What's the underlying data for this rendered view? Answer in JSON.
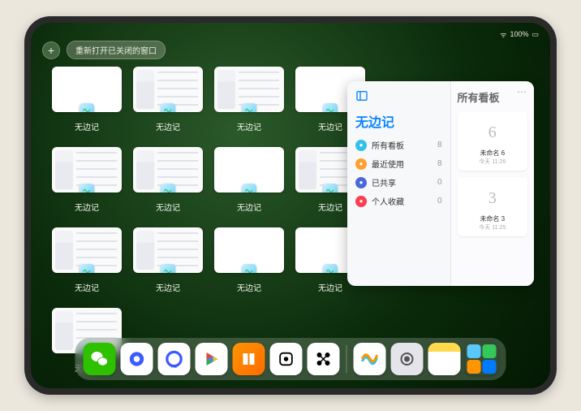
{
  "status": {
    "time": "",
    "battery": "100%",
    "signal": "••••"
  },
  "topbar": {
    "plus_label": "+",
    "reopen_label": "重新打开已关闭的窗口"
  },
  "window_label": "无边记",
  "windows": [
    {
      "variant": "blank"
    },
    {
      "variant": "content"
    },
    {
      "variant": "content"
    },
    {
      "variant": "blank"
    },
    {
      "variant": "content"
    },
    {
      "variant": "content"
    },
    {
      "variant": "blank"
    },
    {
      "variant": "content"
    },
    {
      "variant": "content"
    },
    {
      "variant": "content"
    },
    {
      "variant": "blank"
    },
    {
      "variant": "blank"
    },
    {
      "variant": "content"
    }
  ],
  "panel": {
    "title_left": "无边记",
    "title_right": "所有看板",
    "rows": [
      {
        "icon": "blue",
        "label": "所有看板",
        "count": 8
      },
      {
        "icon": "orange",
        "label": "最近使用",
        "count": 8
      },
      {
        "icon": "navy",
        "label": "已共享",
        "count": 0
      },
      {
        "icon": "red",
        "label": "个人收藏",
        "count": 0
      }
    ],
    "boards": [
      {
        "sketch": "6",
        "name": "未命名 6",
        "sub": "今天 11:26"
      },
      {
        "sketch": "3",
        "name": "未命名 3",
        "sub": "今天 11:25"
      }
    ],
    "more": "⋯"
  },
  "dock": [
    {
      "name": "wechat",
      "bg": "#2dc100",
      "glyph": "wechat"
    },
    {
      "name": "quark",
      "bg": "#ffffff",
      "glyph": "quark"
    },
    {
      "name": "quarkhd",
      "bg": "#ffffff",
      "glyph": "quarkhd"
    },
    {
      "name": "play",
      "bg": "#ffffff",
      "glyph": "play"
    },
    {
      "name": "books",
      "bg": "linear-gradient(135deg,#ff9500,#ff6b00)",
      "glyph": "books"
    },
    {
      "name": "dice",
      "bg": "#ffffff",
      "glyph": "dice"
    },
    {
      "name": "connect",
      "bg": "#ffffff",
      "glyph": "connect"
    },
    {
      "sep": true
    },
    {
      "name": "freeform",
      "bg": "#ffffff",
      "glyph": "freeform"
    },
    {
      "name": "settings",
      "bg": "#e4e4ea",
      "glyph": "gear"
    },
    {
      "name": "notes",
      "bg": "#ffffff",
      "glyph": "notes"
    },
    {
      "name": "recent",
      "bg": "transparent",
      "glyph": "grid"
    }
  ]
}
